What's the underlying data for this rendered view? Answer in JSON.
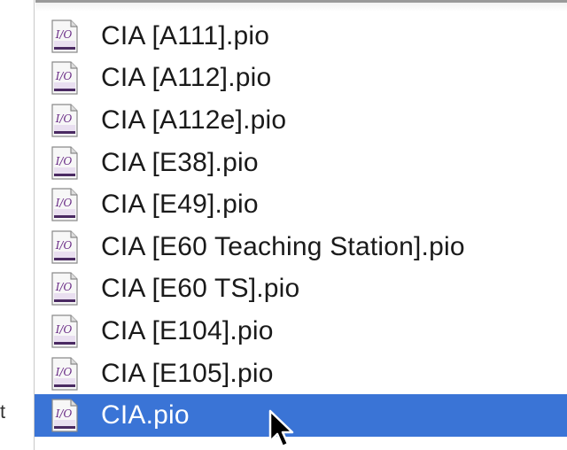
{
  "files": [
    {
      "name": "CIA [A111].pio",
      "selected": false
    },
    {
      "name": "CIA [A112].pio",
      "selected": false
    },
    {
      "name": "CIA [A112e].pio",
      "selected": false
    },
    {
      "name": "CIA [E38].pio",
      "selected": false
    },
    {
      "name": "CIA [E49].pio",
      "selected": false
    },
    {
      "name": "CIA [E60 Teaching Station].pio",
      "selected": false
    },
    {
      "name": "CIA [E60 TS].pio",
      "selected": false
    },
    {
      "name": "CIA [E104].pio",
      "selected": false
    },
    {
      "name": "CIA [E105].pio",
      "selected": false
    },
    {
      "name": "CIA.pio",
      "selected": true
    }
  ],
  "icon": {
    "name": "pio-document-icon",
    "glyph": "I/O"
  },
  "edge_label": "t",
  "colors": {
    "selection": "#3a74d6",
    "icon_accent": "#6a2c86"
  }
}
